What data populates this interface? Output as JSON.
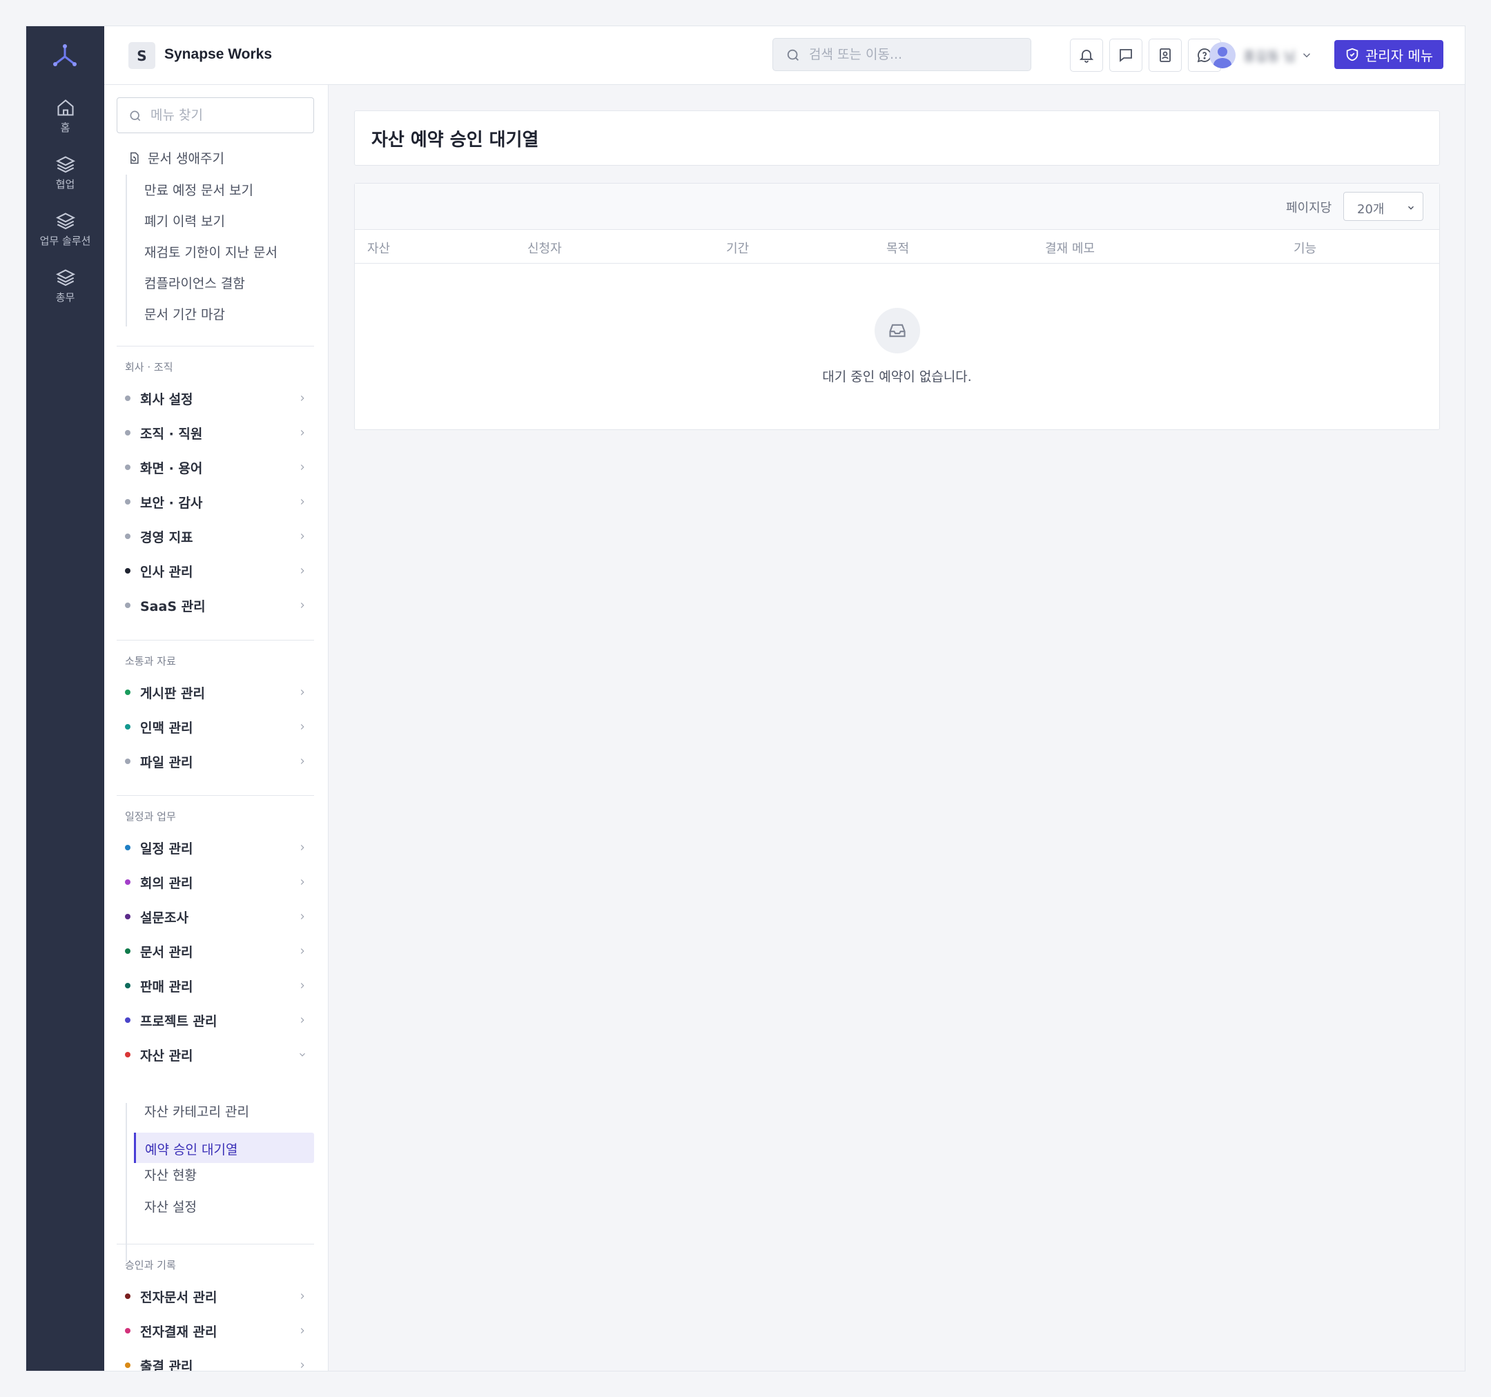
{
  "org": {
    "initial": "S",
    "name": "Synapse Works"
  },
  "header": {
    "search_placeholder": "검색 또는 이동...",
    "user_name": "홍길동 님",
    "admin_label": "관리자 메뉴"
  },
  "rail": [
    {
      "label": "홈",
      "icon": "home-icon"
    },
    {
      "label": "협업",
      "icon": "layers-icon"
    },
    {
      "label": "업무 솔루션",
      "icon": "layers-icon"
    },
    {
      "label": "총무",
      "icon": "layers-icon"
    }
  ],
  "sidebar": {
    "search_placeholder": "메뉴 찾기",
    "lifecycle": {
      "title": "문서 생애주기",
      "items": [
        "만료 예정 문서 보기",
        "폐기 이력 보기",
        "재검토 기한이 지난 문서",
        "컴플라이언스 결함",
        "문서 기간 마감"
      ]
    },
    "sections": [
      {
        "title": "회사 · 조직",
        "items": [
          {
            "label": "회사 설정",
            "color": "#a0a6b4"
          },
          {
            "label": "조직 · 직원",
            "color": "#a0a6b4"
          },
          {
            "label": "화면 · 용어",
            "color": "#a0a6b4"
          },
          {
            "label": "보안 · 감사",
            "color": "#a0a6b4"
          },
          {
            "label": "경영 지표",
            "color": "#a0a6b4"
          },
          {
            "label": "인사 관리",
            "color": "#1f2330"
          },
          {
            "label": "SaaS 관리",
            "color": "#a0a6b4"
          }
        ]
      },
      {
        "title": "소통과 자료",
        "items": [
          {
            "label": "게시판 관리",
            "color": "#1a9b5c"
          },
          {
            "label": "인맥 관리",
            "color": "#14988f"
          },
          {
            "label": "파일 관리",
            "color": "#a0a6b4"
          }
        ]
      },
      {
        "title": "일정과 업무",
        "items": [
          {
            "label": "일정 관리",
            "color": "#1f7fc4"
          },
          {
            "label": "회의 관리",
            "color": "#a33fc9"
          },
          {
            "label": "설문조사",
            "color": "#5b2b8a"
          },
          {
            "label": "문서 관리",
            "color": "#0f7a4a"
          },
          {
            "label": "판매 관리",
            "color": "#0e6b5c"
          },
          {
            "label": "프로젝트 관리",
            "color": "#4a44c9"
          },
          {
            "label": "자산 관리",
            "color": "#d93636"
          }
        ]
      },
      {
        "title": "승인과 기록",
        "items": [
          {
            "label": "전자문서 관리",
            "color": "#7a1f1f"
          },
          {
            "label": "전자결재 관리",
            "color": "#d2317a"
          },
          {
            "label": "출결 관리",
            "color": "#d98a16"
          }
        ]
      }
    ],
    "asset_sub": [
      "자산 카테고리 관리",
      "예약 승인 대기열",
      "자산 현황",
      "자산 설정"
    ]
  },
  "main": {
    "page_title": "자산 예약 승인 대기열",
    "per_page_label": "페이지당",
    "per_page_value": "20개",
    "columns": [
      "자산",
      "신청자",
      "기간",
      "목적",
      "결재 메모",
      "기능"
    ],
    "empty_text": "대기 중인 예약이 없습니다."
  },
  "colors": {
    "accent": "#4a3fd6",
    "rail": "#2b3246"
  }
}
